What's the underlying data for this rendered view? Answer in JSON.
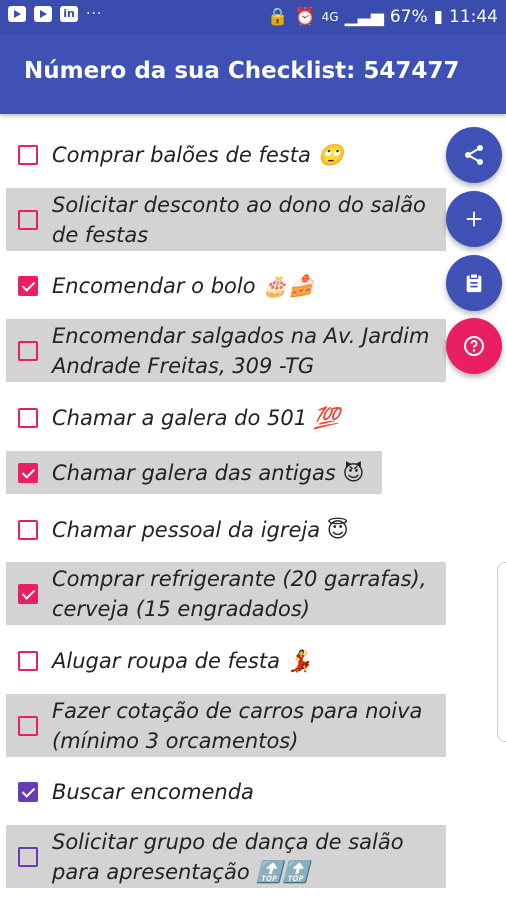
{
  "status_bar": {
    "left_icons": [
      "youtube-icon",
      "youtube-icon",
      "linkedin-icon",
      "more-icon"
    ],
    "linkedin_text": "in",
    "more": "···",
    "battery": "67%",
    "time": "11:44",
    "network": "4G"
  },
  "app_bar": {
    "title": "Número da sua Checklist: 547477"
  },
  "items": [
    {
      "label": "Comprar balões de festa 🙄",
      "checked": false,
      "shaded": false
    },
    {
      "label": "Solicitar desconto ao dono do salão de festas",
      "checked": false,
      "shaded": true
    },
    {
      "label": "Encomendar o bolo 🎂🍰",
      "checked": true,
      "shaded": false
    },
    {
      "label": "Encomendar salgados na Av. Jardim Andrade Freitas, 309 -TG",
      "checked": false,
      "shaded": true
    },
    {
      "label": "Chamar a galera do 501 💯",
      "checked": false,
      "shaded": false
    },
    {
      "label": "Chamar galera das antigas 😈",
      "checked": true,
      "shaded": true
    },
    {
      "label": "Chamar pessoal da igreja 😇",
      "checked": false,
      "shaded": false
    },
    {
      "label": "Comprar refrigerante (20 garrafas), cerveja (15 engradados)",
      "checked": true,
      "shaded": true
    },
    {
      "label": "Alugar roupa de festa 💃",
      "checked": false,
      "shaded": false
    },
    {
      "label": "Fazer cotação de carros para noiva (mínimo 3 orcamentos)",
      "checked": false,
      "shaded": true
    },
    {
      "label": "Buscar encomenda",
      "checked": true,
      "shaded": false
    },
    {
      "label": "Solicitar grupo de dança de salão para apresentação 🔝🔝",
      "checked": false,
      "shaded": true
    }
  ],
  "fabs": [
    {
      "icon": "share-icon",
      "color": "#3f51b5"
    },
    {
      "icon": "add-icon",
      "color": "#3f51b5"
    },
    {
      "icon": "clipboard-icon",
      "color": "#3f51b5"
    },
    {
      "icon": "help-icon",
      "color": "#e91e63"
    }
  ],
  "colors": {
    "primary": "#3f51b5",
    "status_bar": "#3a4dae",
    "accent": "#e91e63",
    "accent_alt": "#673ab7",
    "row_shade": "#d3d3d3"
  }
}
